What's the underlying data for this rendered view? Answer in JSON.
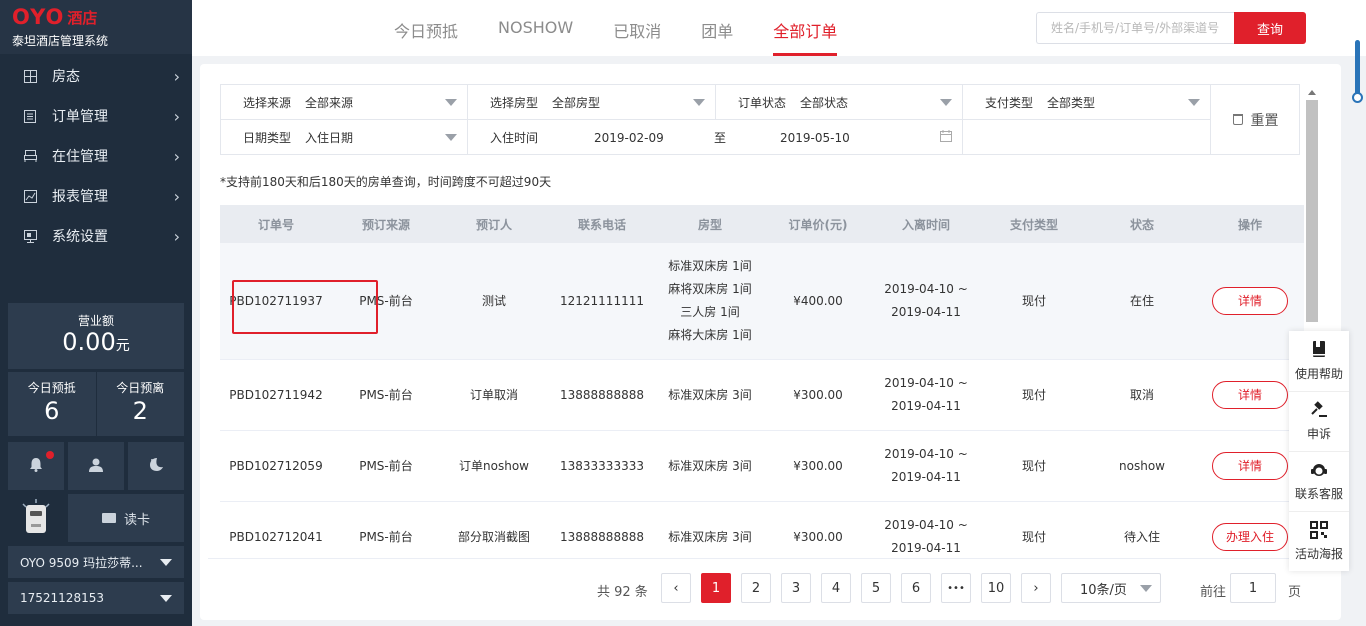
{
  "brand": {
    "logo": "OYO",
    "hotel": "酒店",
    "subtitle": "泰坦酒店管理系统"
  },
  "sidebar": {
    "menu": [
      {
        "label": "房态",
        "icon": "grid-icon"
      },
      {
        "label": "订单管理",
        "icon": "list-icon"
      },
      {
        "label": "在住管理",
        "icon": "bed-icon"
      },
      {
        "label": "报表管理",
        "icon": "chart-icon"
      },
      {
        "label": "系统设置",
        "icon": "settings-icon"
      }
    ],
    "revenue": {
      "label": "营业额",
      "value": "0.00",
      "unit": "元"
    },
    "stats": [
      {
        "label": "今日预抵",
        "value": "6"
      },
      {
        "label": "今日预离",
        "value": "2"
      }
    ],
    "read_card": "读卡",
    "hotel_select": "OYO 9509 玛拉莎蒂...",
    "account_select": "17521128153"
  },
  "tabs": [
    {
      "label": "今日预抵",
      "active": false
    },
    {
      "label": "NOSHOW",
      "active": false
    },
    {
      "label": "已取消",
      "active": false
    },
    {
      "label": "团单",
      "active": false
    },
    {
      "label": "全部订单",
      "active": true
    }
  ],
  "search": {
    "placeholder": "姓名/手机号/订单号/外部渠道号",
    "button": "查询"
  },
  "filters": {
    "source": {
      "label": "选择来源",
      "value": "全部来源"
    },
    "room_type": {
      "label": "选择房型",
      "value": "全部房型"
    },
    "order_status": {
      "label": "订单状态",
      "value": "全部状态"
    },
    "pay_type": {
      "label": "支付类型",
      "value": "全部类型"
    },
    "date_type": {
      "label": "日期类型",
      "value": "入住日期"
    },
    "checkin": {
      "label": "入住时间",
      "from": "2019-02-09",
      "sep": "至",
      "to": "2019-05-10"
    },
    "reset": "重置"
  },
  "note": "*支持前180天和后180天的房单查询，时间跨度不可超过90天",
  "table": {
    "headers": [
      "订单号",
      "预订来源",
      "预订人",
      "联系电话",
      "房型",
      "订单价(元)",
      "入离时间",
      "支付类型",
      "状态",
      "操作"
    ],
    "rows": [
      {
        "order_no": "PBD102711937",
        "source": "PMS-前台",
        "booker": "测试",
        "phone": "12121111111",
        "rooms": [
          "标准双床房 1间",
          "麻将双床房 1间",
          "三人房 1间",
          "麻将大床房 1间"
        ],
        "price": "¥400.00",
        "checkin": "2019-04-10 ~",
        "checkout": "2019-04-11",
        "pay": "现付",
        "status": "在住",
        "action": "详情"
      },
      {
        "order_no": "PBD102711942",
        "source": "PMS-前台",
        "booker": "订单取消",
        "phone": "13888888888",
        "rooms": [
          "标准双床房 3间"
        ],
        "price": "¥300.00",
        "checkin": "2019-04-10 ~",
        "checkout": "2019-04-11",
        "pay": "现付",
        "status": "取消",
        "action": "详情"
      },
      {
        "order_no": "PBD102712059",
        "source": "PMS-前台",
        "booker": "订单noshow",
        "phone": "13833333333",
        "rooms": [
          "标准双床房 3间"
        ],
        "price": "¥300.00",
        "checkin": "2019-04-10 ~",
        "checkout": "2019-04-11",
        "pay": "现付",
        "status": "noshow",
        "action": "详情"
      },
      {
        "order_no": "PBD102712041",
        "source": "PMS-前台",
        "booker": "部分取消截图",
        "phone": "13888888888",
        "rooms": [
          "标准双床房 3间"
        ],
        "price": "¥300.00",
        "checkin": "2019-04-10 ~",
        "checkout": "2019-04-11",
        "pay": "现付",
        "status": "待入住",
        "action": "办理入住"
      }
    ]
  },
  "pagination": {
    "total": "共 92 条",
    "pages": [
      "1",
      "2",
      "3",
      "4",
      "5",
      "6",
      "•••",
      "10"
    ],
    "current": "1",
    "page_size": "10条/页",
    "goto_label": "前往",
    "goto_value": "1",
    "goto_unit": "页"
  },
  "help_panel": [
    {
      "label": "使用帮助",
      "icon": "book-icon"
    },
    {
      "label": "申诉",
      "icon": "gavel-icon"
    },
    {
      "label": "联系客服",
      "icon": "headset-icon"
    },
    {
      "label": "活动海报",
      "icon": "qrcode-icon"
    }
  ],
  "colors": {
    "accent": "#e0202b",
    "sidebar_bg": "#1f2d3d",
    "sidebar_card": "#2d3c4e"
  }
}
